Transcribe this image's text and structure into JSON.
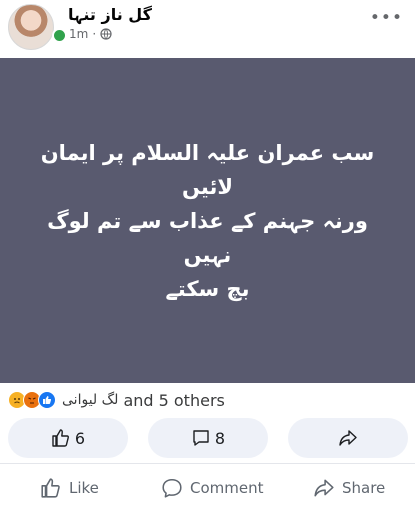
{
  "post": {
    "author": "گل ناز تنہا",
    "time": "1m",
    "separator": "·",
    "more_label": "•••",
    "text_lines": [
      "سب عمران علیہ السلام پر ایمان",
      "لائیں",
      "ورنہ جہنم کے عذاب سے تم لوگ نہیں",
      "بچ سکتے"
    ],
    "background_color": "#595a6f"
  },
  "reactions": {
    "emojis": [
      "sad-face-icon",
      "angry-face-icon",
      "like-reaction-icon"
    ],
    "name": "لگ لیوانی",
    "others": "and 5 others"
  },
  "stats": {
    "likes": "6",
    "comments": "8"
  },
  "actions": {
    "like": "Like",
    "comment": "Comment",
    "share": "Share"
  },
  "colors": {
    "accent": "#1877f2",
    "online": "#31a24c",
    "pill": "#eef1f8"
  }
}
